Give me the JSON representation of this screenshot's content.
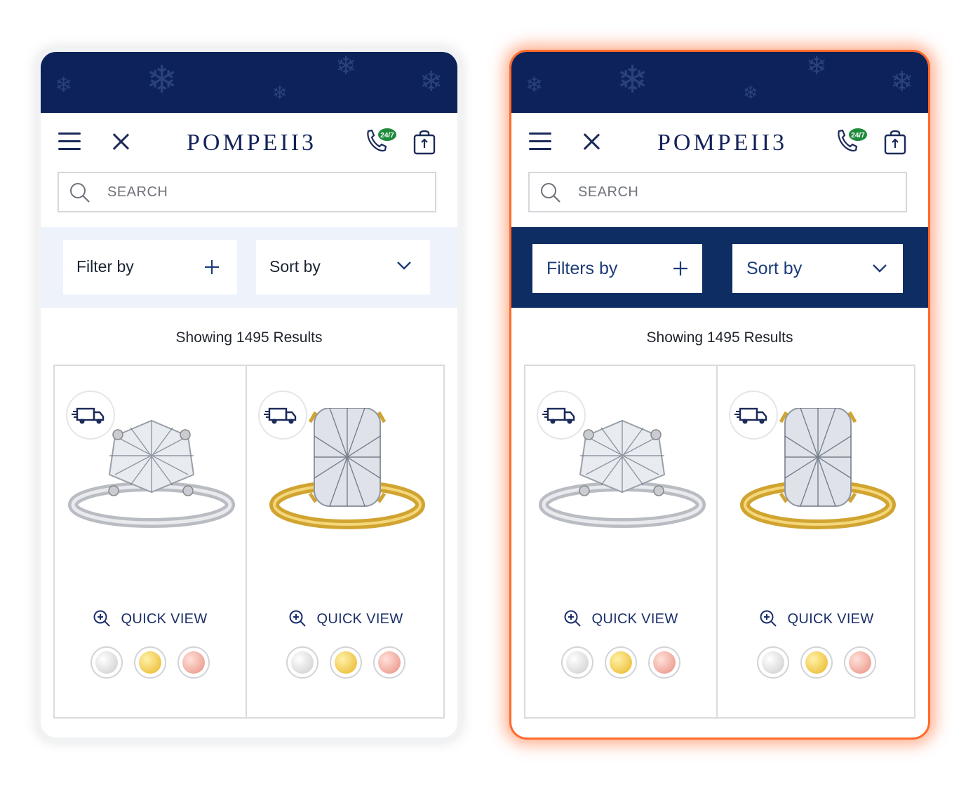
{
  "brand": {
    "logo_text": "POMPEII3",
    "navy": "#0d2258",
    "accent_glow": "#ff6a2b"
  },
  "icons": [
    "menu-icon",
    "close-icon",
    "phone-24-7-icon",
    "shopping-bag-icon",
    "search-icon",
    "plus-icon",
    "chevron-down-icon",
    "delivery-truck-icon",
    "zoom-in-icon"
  ],
  "phones": {
    "left": {
      "search_placeholder": "SEARCH",
      "phone_badge": "24/7",
      "filter_label": "Filter by",
      "sort_label": "Sort by",
      "results_text": "Showing 1495 Results",
      "products": [
        {
          "quick_view": "QUICK VIEW",
          "metal": "white",
          "swatches": [
            "#d9dadc",
            "#f2c63a",
            "#f0a296"
          ]
        },
        {
          "quick_view": "QUICK VIEW",
          "metal": "yellow",
          "swatches": [
            "#d9dadc",
            "#f2c63a",
            "#f0a296"
          ]
        }
      ]
    },
    "right": {
      "search_placeholder": "SEARCH",
      "phone_badge": "24/7",
      "filter_label": "Filters by",
      "sort_label": "Sort by",
      "results_text": "Showing 1495 Results",
      "products": [
        {
          "quick_view": "QUICK VIEW",
          "metal": "white",
          "swatches": [
            "#d9dadc",
            "#f2c63a",
            "#f0a296"
          ]
        },
        {
          "quick_view": "QUICK VIEW",
          "metal": "yellow",
          "swatches": [
            "#d9dadc",
            "#f2c63a",
            "#f0a296"
          ]
        }
      ]
    }
  }
}
